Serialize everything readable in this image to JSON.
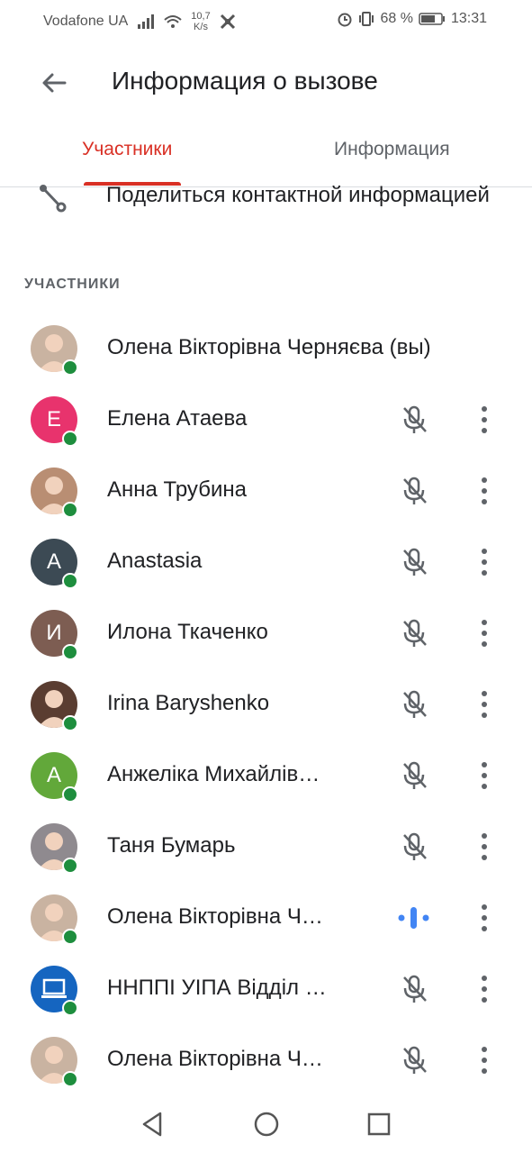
{
  "status": {
    "carrier": "Vodafone UA",
    "speed_top": "10,7",
    "speed_bottom": "K/s",
    "battery": "68 %",
    "time": "13:31"
  },
  "header": {
    "title": "Информация о вызове"
  },
  "tabs": [
    "Участники",
    "Информация"
  ],
  "share": {
    "label": "Поделиться контактной информацией"
  },
  "section_label": "УЧАСТНИКИ",
  "participants": [
    {
      "name": "Олена Вікторівна Черняєва (вы)",
      "initial": "",
      "color": "#c9b3a1",
      "photo": true,
      "mic": "none"
    },
    {
      "name": "Елена Атаева",
      "initial": "E",
      "color": "#e8336d",
      "photo": false,
      "mic": "muted"
    },
    {
      "name": "Анна Трубина",
      "initial": "",
      "color": "#b98e73",
      "photo": true,
      "mic": "muted"
    },
    {
      "name": "Anastasia",
      "initial": "A",
      "color": "#3c4a54",
      "photo": false,
      "mic": "muted"
    },
    {
      "name": "Илона Ткаченко",
      "initial": "И",
      "color": "#7d5d52",
      "photo": false,
      "mic": "muted"
    },
    {
      "name": "Irina Baryshenko",
      "initial": "",
      "color": "#5a3d31",
      "photo": true,
      "mic": "muted"
    },
    {
      "name": "Анжеліка Михайлів…",
      "initial": "A",
      "color": "#62a83a",
      "photo": false,
      "mic": "muted"
    },
    {
      "name": "Таня Бумарь",
      "initial": "",
      "color": "#8f8a8f",
      "photo": true,
      "mic": "muted"
    },
    {
      "name": "Олена Вікторівна Ч…",
      "initial": "",
      "color": "#c9b3a1",
      "photo": true,
      "mic": "speaking"
    },
    {
      "name": "ННППІ УІПА Відділ …",
      "initial": "",
      "color": "#1565c0",
      "photo": false,
      "icon": "laptop-icon",
      "mic": "muted"
    },
    {
      "name": "Олена Вікторівна Ч…",
      "initial": "",
      "color": "#c9b3a1",
      "photo": true,
      "mic": "muted"
    }
  ],
  "colors": {
    "accent": "#d93025",
    "online": "#1e8e3e",
    "speaking": "#4285f4"
  }
}
